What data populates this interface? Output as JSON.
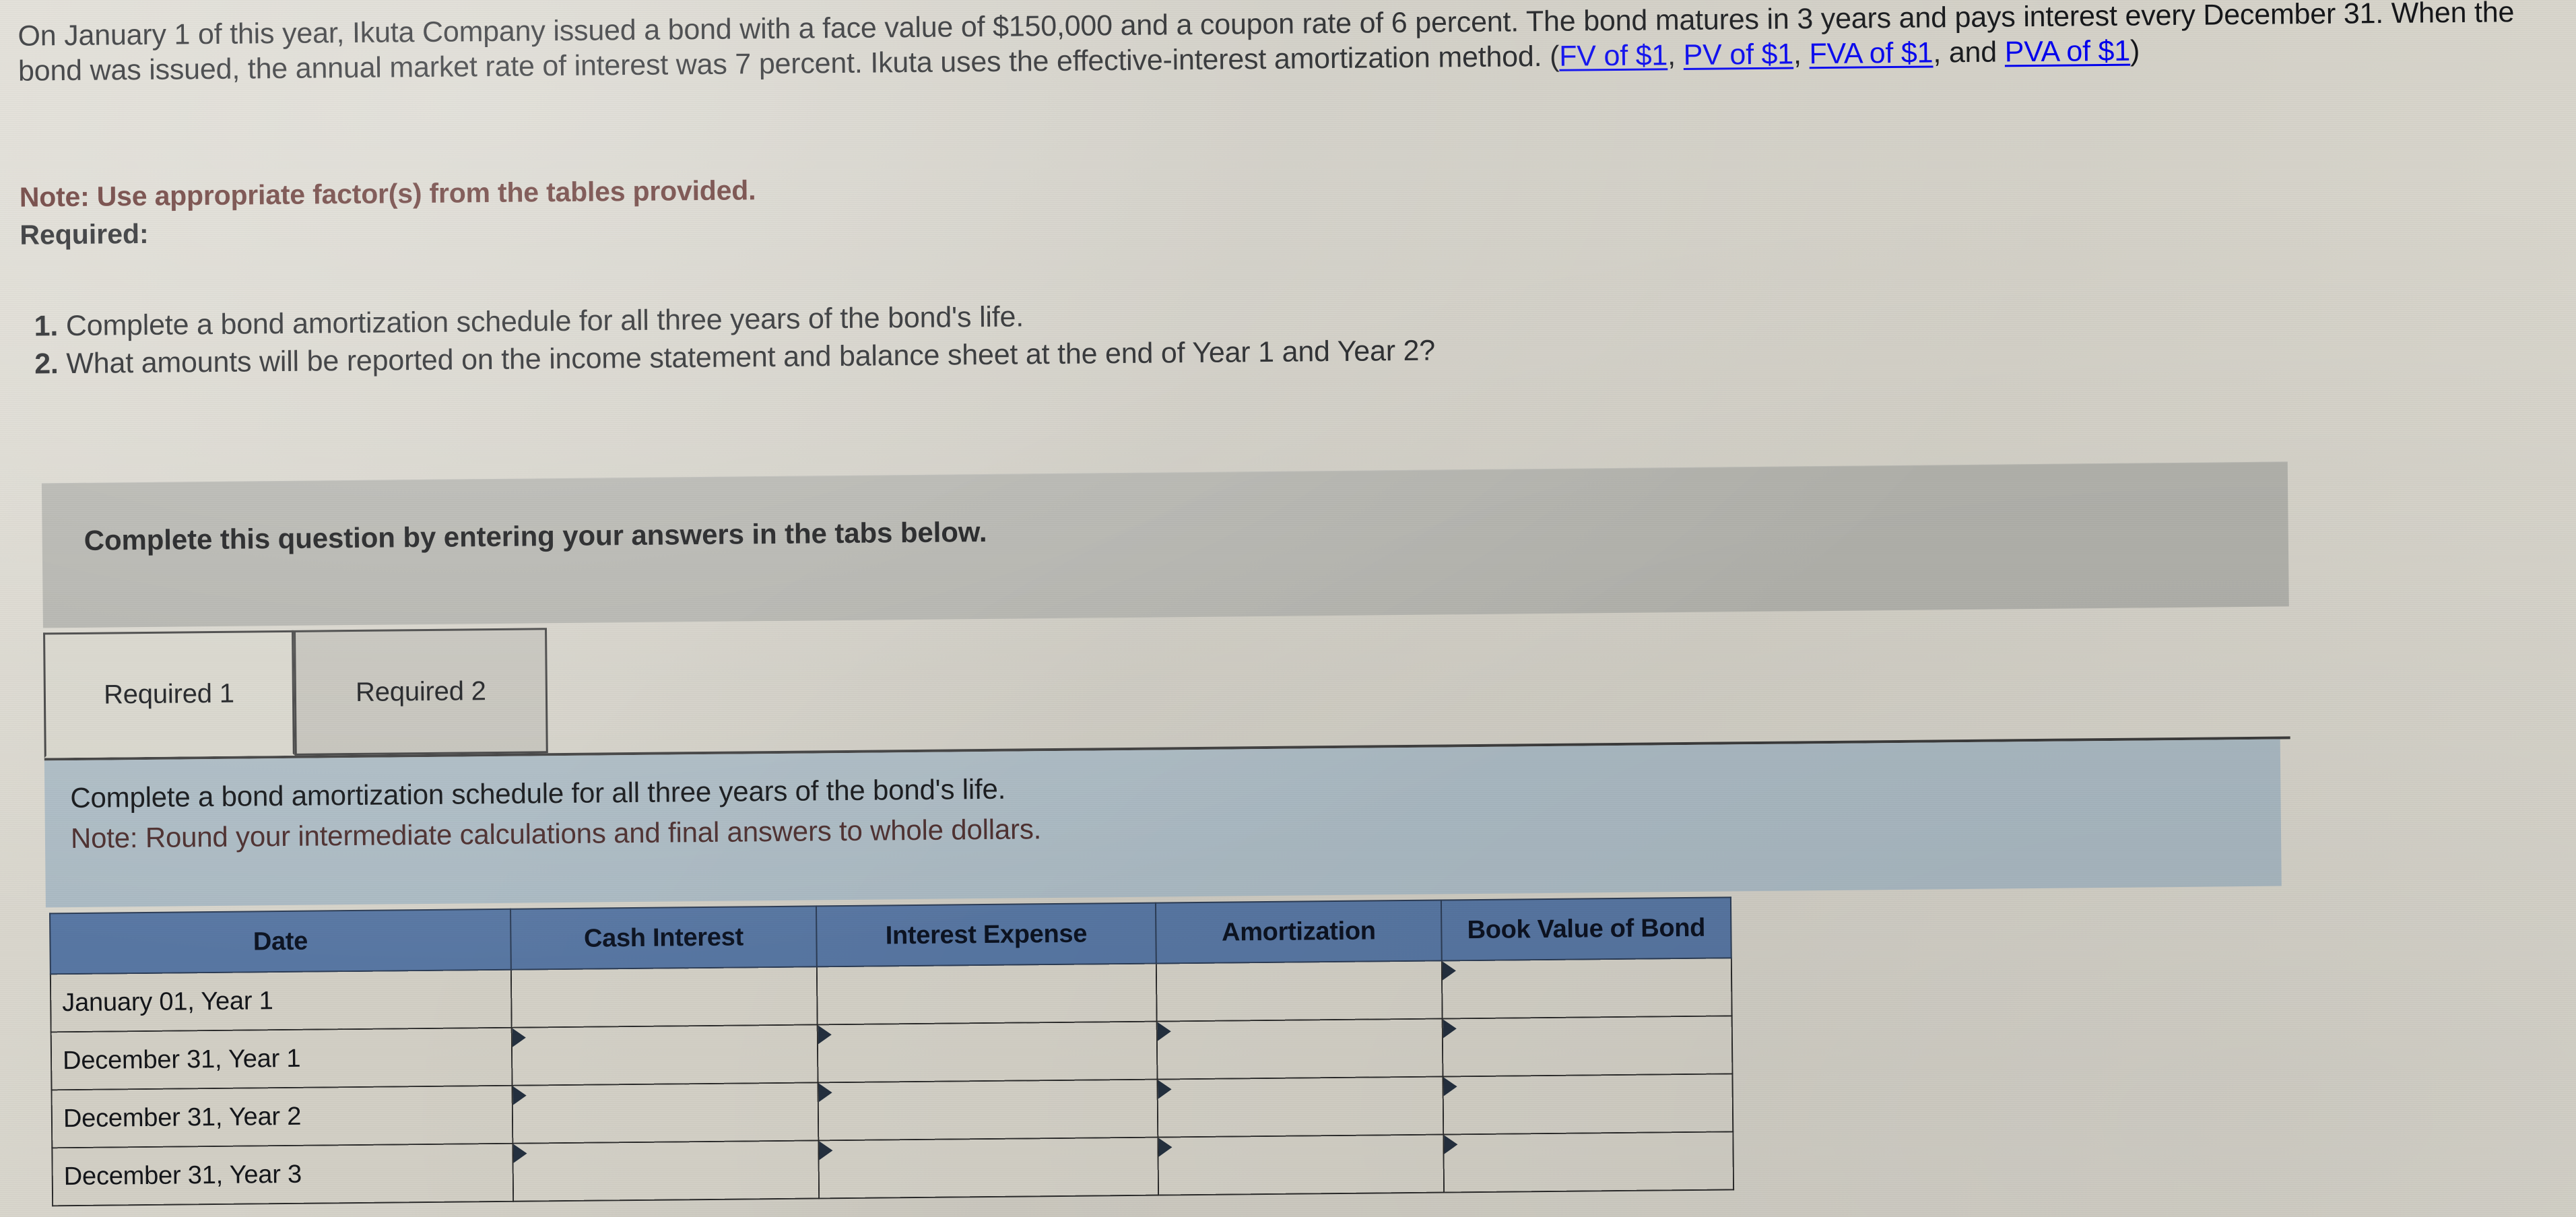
{
  "problem": {
    "paragraph_lines": [
      "On January 1 of this year, Ikuta Company issued a bond with a face value of $150,000 and a coupon rate of 6 percent. The bond",
      "matures in 3 years and pays interest every December 31. When the bond was issued, the annual market rate of interest was 7 percent.",
      "Ikuta uses the effective-interest amortization method."
    ],
    "factor_links_prefix": "(",
    "factor_links": [
      "FV of $1",
      "PV of $1",
      "FVA of $1",
      "PVA of $1"
    ],
    "note": "Note: Use appropriate factor(s) from the tables provided.",
    "required_label": "Required:",
    "requirements": [
      {
        "num": "1.",
        "text": "Complete a bond amortization schedule for all three years of the bond's life."
      },
      {
        "num": "2.",
        "text": "What amounts will be reported on the income statement and balance sheet at the end of Year 1 and Year 2?"
      }
    ]
  },
  "grey_banner": {
    "text": "Complete this question by entering your answers in the tabs below."
  },
  "tabs": [
    {
      "label": "Required 1",
      "active": true
    },
    {
      "label": "Required 2",
      "active": false
    }
  ],
  "blue_panel": {
    "line1": "Complete a bond amortization schedule for all three years of the bond's life.",
    "line2": "Note: Round your intermediate calculations and final answers to whole dollars."
  },
  "amortization_table": {
    "columns": [
      "Date",
      "Cash Interest",
      "Interest Expense",
      "Amortization",
      "Book Value of Bond"
    ],
    "rows": [
      {
        "date": "January 01, Year 1",
        "cash_interest": "",
        "interest_expense": "",
        "amortization": "",
        "book_value": ""
      },
      {
        "date": "December 31, Year 1",
        "cash_interest": "",
        "interest_expense": "",
        "amortization": "",
        "book_value": ""
      },
      {
        "date": "December 31, Year 2",
        "cash_interest": "",
        "interest_expense": "",
        "amortization": "",
        "book_value": ""
      },
      {
        "date": "December 31, Year 3",
        "cash_interest": "",
        "interest_expense": "",
        "amortization": "",
        "book_value": ""
      }
    ]
  },
  "colors": {
    "page_background": "#d8d5cb",
    "grey_banner": "#b2b2ac",
    "blue_panel": "#abbac3",
    "table_header": "#5877a3",
    "note_red": "#582521",
    "active_tab": "#d7d5cb",
    "inactive_tab": "#c4c2ba"
  }
}
